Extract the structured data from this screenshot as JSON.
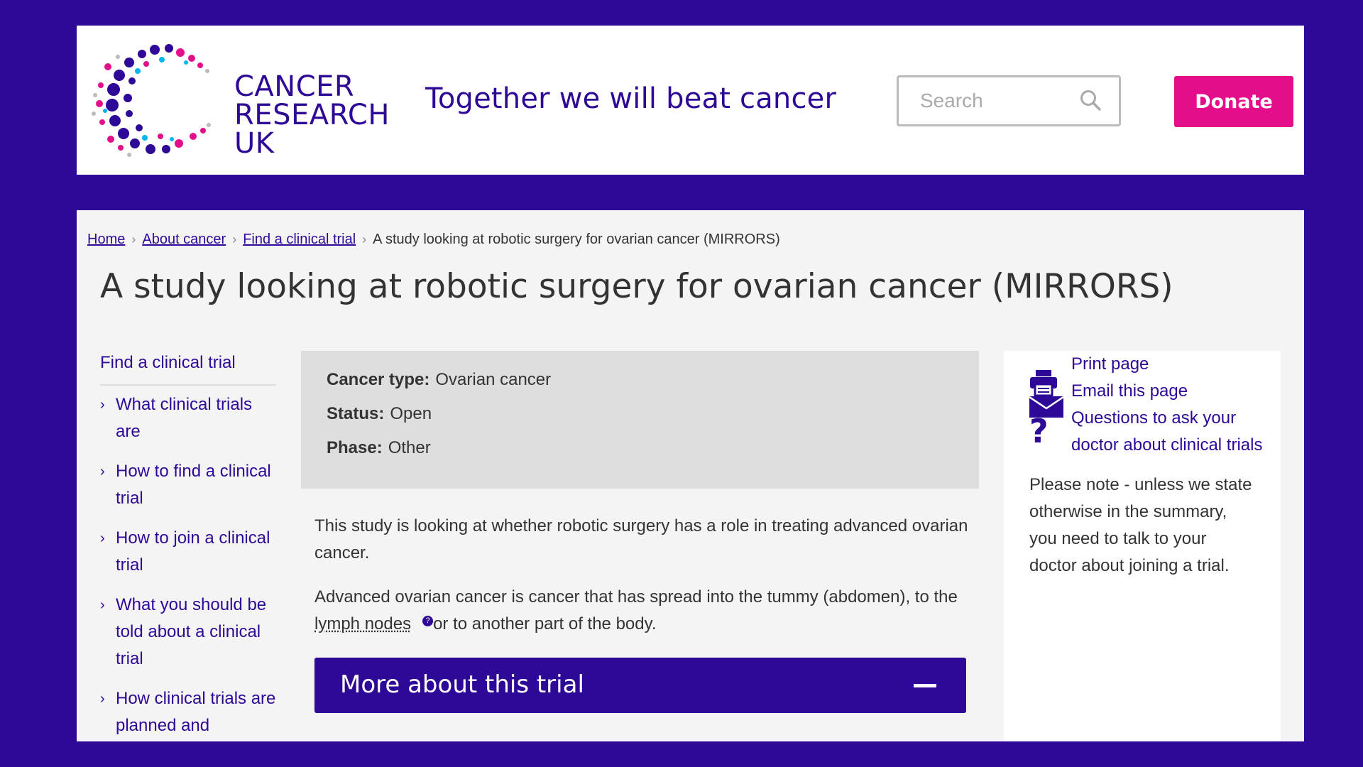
{
  "header": {
    "logo": {
      "line1": "CANCER",
      "line2": "RESEARCH",
      "line3": "UK"
    },
    "tagline": "Together we will beat cancer",
    "search": {
      "placeholder": "Search",
      "value": ""
    },
    "donate_label": "Donate"
  },
  "breadcrumb": [
    {
      "label": "Home"
    },
    {
      "label": "About cancer"
    },
    {
      "label": "Find a clinical trial"
    },
    {
      "label": "A study looking at robotic surgery for ovarian cancer (MIRRORS)"
    }
  ],
  "page_title": "A study looking at robotic surgery for ovarian cancer (MIRRORS)",
  "left_nav": {
    "heading": "Find a clinical trial",
    "items": [
      {
        "label": "What clinical trials are"
      },
      {
        "label": "How to find a clinical trial"
      },
      {
        "label": "How to join a clinical trial"
      },
      {
        "label": "What you should be told about a clinical trial"
      },
      {
        "label": "How clinical trials are planned and"
      }
    ]
  },
  "summary": {
    "cancer_type": {
      "label": "Cancer type:",
      "value": "Ovarian cancer"
    },
    "status": {
      "label": "Status:",
      "value": "Open"
    },
    "phase": {
      "label": "Phase:",
      "value": "Other"
    }
  },
  "body": {
    "p1": "This study is looking at whether robotic surgery has a role in treating advanced ovarian cancer.",
    "p2_before": "Advanced ovarian cancer is cancer that has spread into the tummy (abdomen), to the",
    "p2_link": "lymph nodes",
    "p2_after": "or to another part of the body."
  },
  "accordion": {
    "label": "More about this trial",
    "state": "expanded"
  },
  "sidebar": {
    "print_label": "Print page",
    "email_label": "Email this page",
    "questions_label": "Questions to ask your doctor about clinical trials",
    "note": "Please note - unless we state otherwise in the summary, you need to talk to your doctor about joining a trial."
  },
  "colors": {
    "brand_purple": "#2e0896",
    "donate_pink": "#e40e8a",
    "background": "#2e0896"
  }
}
